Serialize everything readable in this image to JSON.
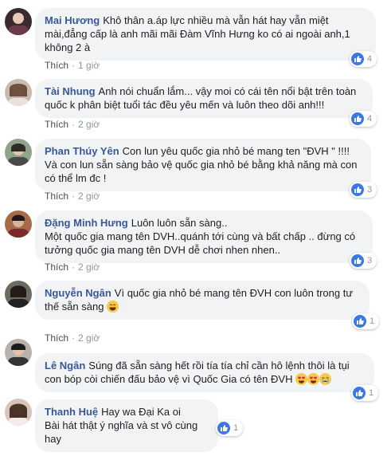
{
  "colors": {
    "author": "#385898",
    "bubble": "#f2f3f5",
    "meta": "#90949c",
    "like_badge": "#3b78e7"
  },
  "action_like_label": "Thích",
  "comments": [
    {
      "author": "Mai Hương",
      "text": "Khô thân a.áp lực nhiều mà vẫn hát hay vẫn miệt mài,đẳng cấp là anh mãi mãi Đàm Vĩnh Hưng ko có ai ngoài anh,1 không 2 à",
      "time": "1 giờ",
      "reactions": "4",
      "avatar_icon": "user-avatar"
    },
    {
      "author": "Tài Nhung",
      "text": "Anh nói chuẩn lắm... vậy moi có cái tên nổi bật trên toàn quốc k phân biệt tuổi tác đều yêu mến và luôn theo dõi anh!!!",
      "time": "2 giờ",
      "reactions": "4",
      "avatar_icon": "user-avatar"
    },
    {
      "author": "Phan Thúy Yên",
      "text": "Con lun yêu quốc gia nhỏ bé mang ten \"ĐVH \" !!!!\nVà con lun sẵn sàng bảo vệ quốc gia nhỏ bé bằng khả năng mà con có thể lm đc !",
      "time": "2 giờ",
      "reactions": "3",
      "avatar_icon": "user-avatar"
    },
    {
      "author": "Đặng Minh Hưng",
      "text": "Luôn luôn sẵn sàng..\nMột quốc gia mang tên DVH..quánh tới cùng và bất chấp .. đừng có tưởng quốc gia mang tên DVH dễ chơi nhen nhen..",
      "time": "2 giờ",
      "reactions": "3",
      "avatar_icon": "user-avatar"
    },
    {
      "author": "Nguyễn Ngân",
      "text": "Vì quốc gia nhỏ bé mang tên ĐVH con luôn trong tư thế sẵn sàng",
      "time": "2 giờ",
      "reactions": "1",
      "avatar_icon": "user-avatar",
      "emojis": [
        "grinning-face-emoji"
      ]
    },
    {
      "author": "Lê Ngân",
      "text": "Súng đã sẵn sàng hết rồi tía tía chỉ cần hô lệnh thôi là tụi con bóp còi chiến đấu bảo vệ vì Quốc Gia có tên ĐVH",
      "time": "2 giờ",
      "reactions": "1",
      "avatar_icon": "user-avatar",
      "emojis": [
        "heart-eyes-emoji",
        "heart-eyes-emoji",
        "crying-face-emoji"
      ]
    },
    {
      "author": "Thanh Huệ",
      "text": "Hay wa Đại Ka oi\nBài hát thật ý nghĩa và st vô cùng hay",
      "time": "",
      "reactions": "1",
      "avatar_icon": "user-avatar"
    }
  ]
}
